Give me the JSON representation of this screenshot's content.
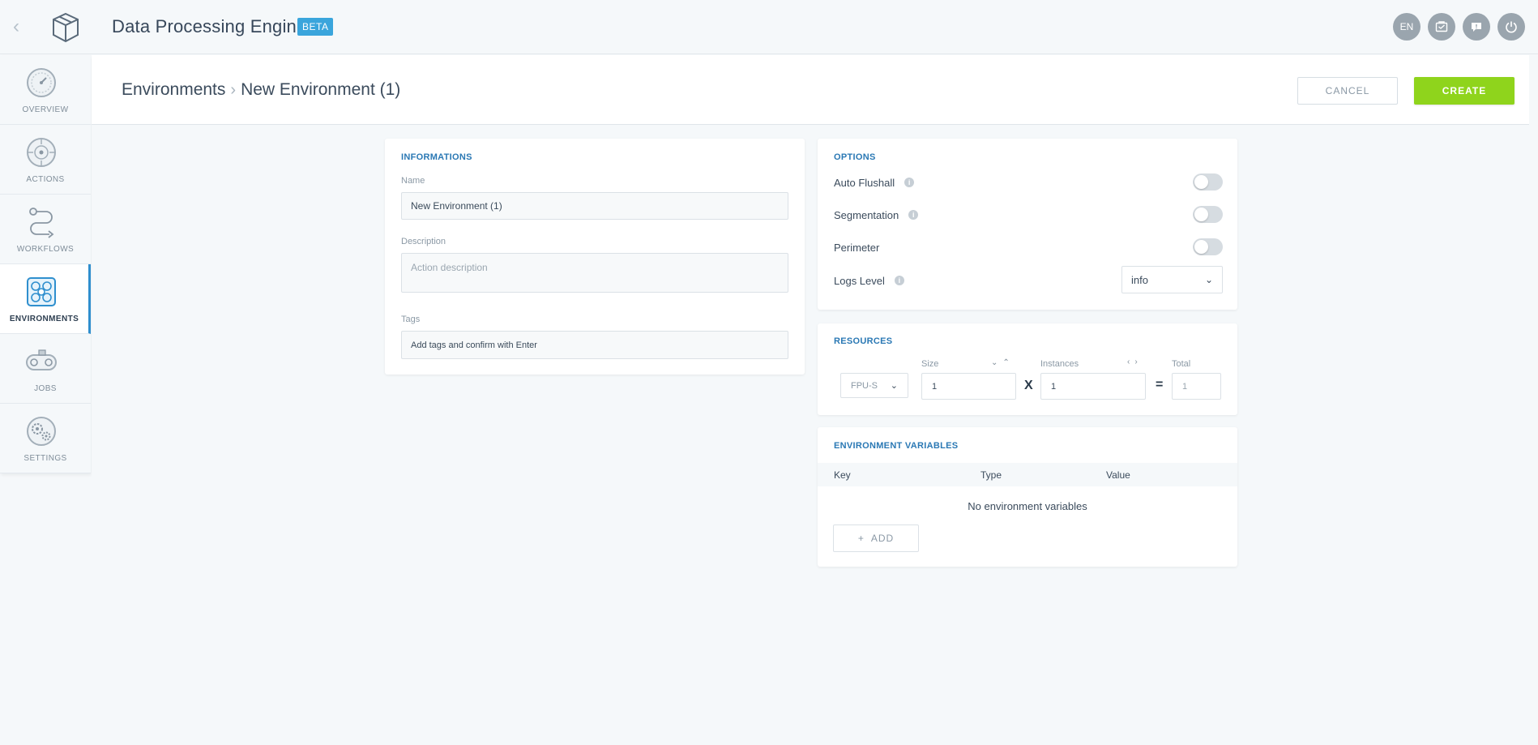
{
  "app": {
    "title": "Data Processing Engine",
    "badge": "BETA"
  },
  "topbar": {
    "lang": "EN",
    "icons": [
      "back-arrow-icon",
      "app-box-icon",
      "clipboard-icon",
      "chat-icon",
      "power-icon"
    ]
  },
  "sidebar": {
    "items": [
      {
        "label": "OVERVIEW",
        "icon": "gauge-icon",
        "active": false
      },
      {
        "label": "ACTIONS",
        "icon": "target-icon",
        "active": false
      },
      {
        "label": "WORKFLOWS",
        "icon": "workflow-icon",
        "active": false
      },
      {
        "label": "ENVIRONMENTS",
        "icon": "environments-icon",
        "active": true
      },
      {
        "label": "JOBS",
        "icon": "conveyor-icon",
        "active": false
      },
      {
        "label": "SETTINGS",
        "icon": "gears-icon",
        "active": false
      }
    ]
  },
  "header": {
    "breadcrumb": [
      "Environments",
      "New Environment (1)"
    ],
    "cancel_label": "CANCEL",
    "create_label": "CREATE"
  },
  "informations": {
    "title": "INFORMATIONS",
    "name_label": "Name",
    "name_value": "New Environment (1)",
    "description_label": "Description",
    "description_placeholder": "Action description",
    "tags_label": "Tags",
    "tags_placeholder": "Add tags and confirm with Enter"
  },
  "options": {
    "title": "OPTIONS",
    "auto_flushall": "Auto Flushall",
    "segmentation": "Segmentation",
    "perimeter": "Perimeter",
    "logs_level": "Logs Level",
    "logs_level_value": "info"
  },
  "resources": {
    "title": "RESOURCES",
    "fpu_value": "FPU-S",
    "size_label": "Size",
    "size_value": "1",
    "instances_label": "Instances",
    "instances_value": "1",
    "total_label": "Total",
    "total_value": "1",
    "multiply": "X",
    "equals": "="
  },
  "env_variables": {
    "title": "ENVIRONMENT VARIABLES",
    "columns": [
      "Key",
      "Type",
      "Value"
    ],
    "empty_message": "No environment variables",
    "add_label": "ADD"
  },
  "colors": {
    "accent": "#2f8fce",
    "create": "#8fd41c",
    "beta": "#3aa5dc"
  }
}
